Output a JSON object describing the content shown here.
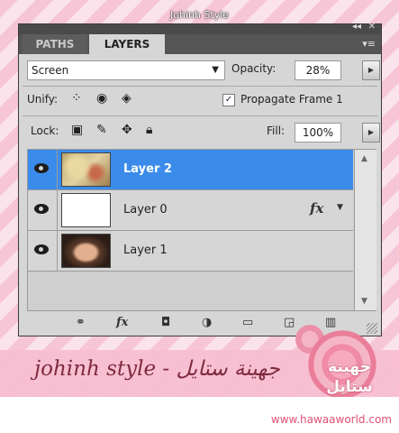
{
  "watermark_top": "Johinh Style",
  "panel": {
    "topbar": {
      "collapse_icon": "◂◂",
      "close_icon": "✕"
    },
    "tabs": [
      {
        "label": "PATHS"
      },
      {
        "label": "LAYERS"
      }
    ],
    "menu_icon": "▾≡",
    "blend_mode": "Screen",
    "opacity_label": "Opacity:",
    "opacity_value": "28%",
    "unify_label": "Unify:",
    "propagate_label": "Propagate Frame 1",
    "propagate_checked": true,
    "lock_label": "Lock:",
    "fill_label": "Fill:",
    "fill_value": "100%",
    "layers": [
      {
        "name": "Layer 2",
        "selected": true,
        "visible": true,
        "fx": false
      },
      {
        "name": "Layer 0",
        "selected": false,
        "visible": true,
        "fx": true,
        "fx_label": "fx"
      },
      {
        "name": "Layer 1",
        "selected": false,
        "visible": true,
        "fx": false
      }
    ],
    "bottom_fx_label": "fx"
  },
  "banner": {
    "text": "johinh style - جهينة ستايل",
    "logo_text": "جهينة ستايل",
    "url": "www.hawaaworld.com"
  },
  "colors": {
    "selection": "#3b8bea",
    "panel_bg": "#d6d6d6",
    "banner_bg": "#f8bed2"
  }
}
